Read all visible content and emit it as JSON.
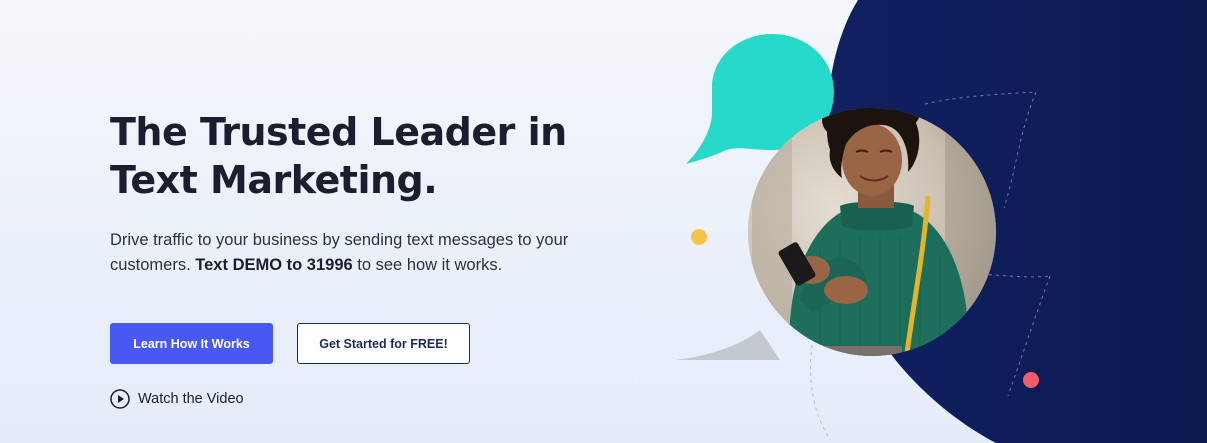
{
  "hero": {
    "headline_line1": "The Trusted Leader in",
    "headline_line2": "Text Marketing.",
    "subcopy_before": "Drive traffic to your business by sending text messages to your customers. ",
    "subcopy_strong": "Text DEMO to 31996",
    "subcopy_after": " to see how it works."
  },
  "buttons": {
    "primary_label": "Learn How It Works",
    "secondary_label": "Get Started for FREE!"
  },
  "video": {
    "label": "Watch the Video",
    "icon": "play-circle-icon"
  },
  "illustration": {
    "photo_subject": "woman-texting-photo",
    "bubble_icon": "speech-bubble-icon"
  },
  "colors": {
    "primary": "#4859f2",
    "navy": "#0f1f5e",
    "teal": "#27d9c8",
    "yellow": "#f5c24a",
    "coral": "#f25c6a",
    "text": "#1b1e2e"
  }
}
